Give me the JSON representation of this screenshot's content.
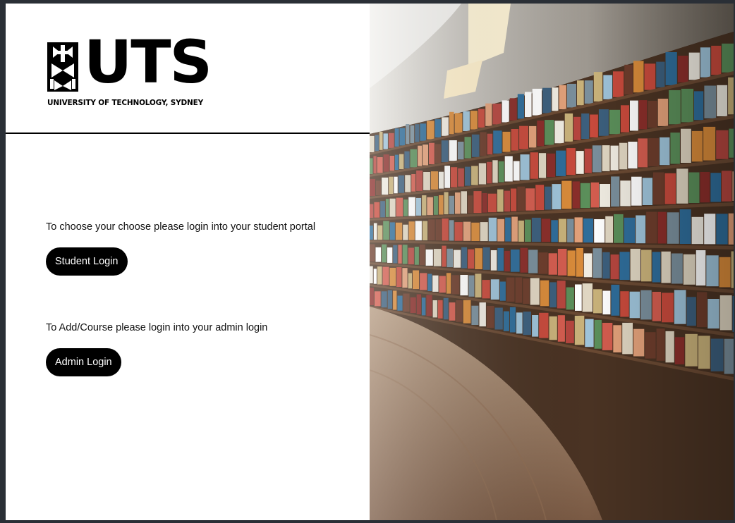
{
  "brand": {
    "wordmark": "UTS",
    "subtitle": "UNIVERSITY OF TECHNOLOGY, SYDNEY",
    "logo_icon": "uts-emblem-icon"
  },
  "student": {
    "prompt": "To choose your choose please login into your student portal",
    "button_label": "Student Login"
  },
  "admin": {
    "prompt": "To Add/Course please login into your admin login",
    "button_label": "Admin Login"
  },
  "hero_image": {
    "subject": "library-bookshelves-image"
  },
  "colors": {
    "button_bg": "#000000",
    "button_text": "#ffffff",
    "page_bg": "#ffffff",
    "outer_bg": "#2a2f36"
  }
}
